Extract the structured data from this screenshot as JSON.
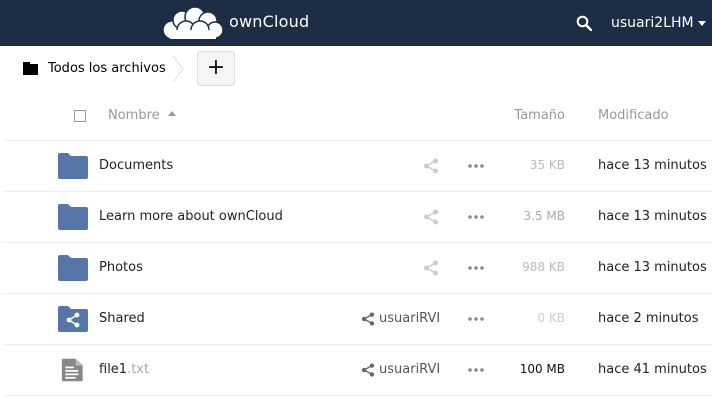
{
  "header": {
    "brand": "ownCloud",
    "user_label": "usuari2LHM",
    "colors": {
      "bar": "#1d2d44",
      "folder": "#5576a6"
    }
  },
  "controls": {
    "breadcrumb_label": "Todos los archivos",
    "new_button_label": "+"
  },
  "table": {
    "columns": {
      "name": "Nombre",
      "size": "Tamaño",
      "modified": "Modificado"
    },
    "rows": [
      {
        "name": "Documents",
        "ext": "",
        "icon": "folder-icon",
        "shared_with": "",
        "size": "35 KB",
        "modified": "hace 13 minutos"
      },
      {
        "name": "Learn more about ownCloud",
        "ext": "",
        "icon": "folder-icon",
        "shared_with": "",
        "size": "3.5 MB",
        "modified": "hace 13 minutos"
      },
      {
        "name": "Photos",
        "ext": "",
        "icon": "folder-icon",
        "shared_with": "",
        "size": "988 KB",
        "modified": "hace 13 minutos"
      },
      {
        "name": "Shared",
        "ext": "",
        "icon": "shared-folder-icon",
        "shared_with": "usuariRVI",
        "size": "0 KB",
        "modified": "hace 2 minutos"
      },
      {
        "name": "file1",
        "ext": ".txt",
        "icon": "text-file-icon",
        "shared_with": "usuariRVI",
        "size": "100 MB",
        "modified": "hace 41 minutos"
      }
    ]
  }
}
